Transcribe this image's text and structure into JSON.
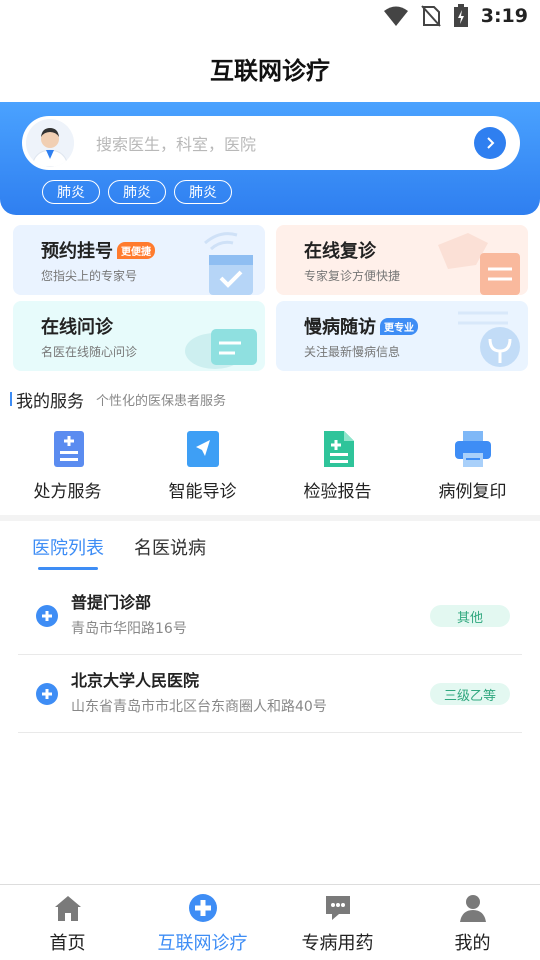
{
  "status": {
    "time": "3:19",
    "icons": [
      "wifi-icon",
      "no-sim-icon",
      "battery-charging-icon"
    ]
  },
  "header": {
    "title": "互联网诊疗"
  },
  "search": {
    "placeholder": "搜索医生，科室，医院",
    "tags": [
      "肺炎",
      "肺炎",
      "肺炎"
    ]
  },
  "cards": [
    {
      "title": "预约挂号",
      "badge": "更便捷",
      "subtitle": "您指尖上的专家号"
    },
    {
      "title": "在线复诊",
      "badge": "",
      "subtitle": "专家复诊方便快捷"
    },
    {
      "title": "在线问诊",
      "badge": "",
      "subtitle": "名医在线随心问诊"
    },
    {
      "title": "慢病随访",
      "badge": "更专业",
      "subtitle": "关注最新慢病信息"
    }
  ],
  "services": {
    "title": "我的服务",
    "subtitle": "个性化的医保患者服务",
    "items": [
      {
        "label": "处方服务",
        "icon": "prescription-icon"
      },
      {
        "label": "智能导诊",
        "icon": "navigation-icon"
      },
      {
        "label": "检验报告",
        "icon": "report-icon"
      },
      {
        "label": "病例复印",
        "icon": "printer-icon"
      }
    ]
  },
  "tabs": [
    {
      "label": "医院列表"
    },
    {
      "label": "名医说病"
    }
  ],
  "hospitals": [
    {
      "name": "普提门诊部",
      "address": "青岛市华阳路16号",
      "level": "其他"
    },
    {
      "name": "北京大学人民医院",
      "address": "山东省青岛市市北区台东商圈人和路40号",
      "level": "三级乙等"
    }
  ],
  "bottom_nav": [
    {
      "label": "首页",
      "icon": "home-icon"
    },
    {
      "label": "互联网诊疗",
      "icon": "medical-cross-icon"
    },
    {
      "label": "专病用药",
      "icon": "chat-icon"
    },
    {
      "label": "我的",
      "icon": "user-icon"
    }
  ],
  "colors": {
    "accent": "#3e8df5",
    "badge_orange": "#ff7b2e",
    "level_green": "#2fa77e"
  }
}
